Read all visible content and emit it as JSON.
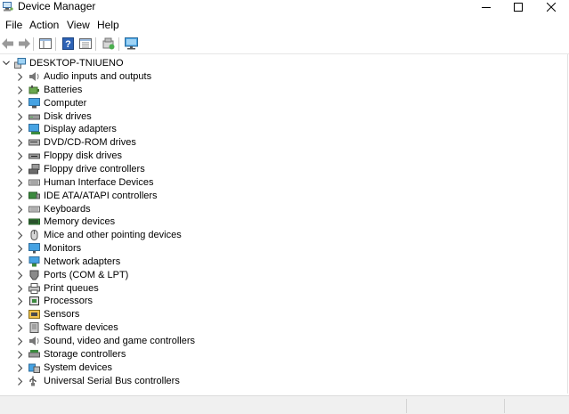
{
  "window": {
    "title": "Device Manager"
  },
  "menu": [
    "File",
    "Action",
    "View",
    "Help"
  ],
  "toolbar": {
    "buttons": [
      "back-arrow-icon",
      "forward-arrow-icon",
      "properties-panel-icon",
      "help-icon",
      "details-view-icon",
      "update-driver-icon",
      "monitor-scan-icon"
    ]
  },
  "tree": {
    "root": "DESKTOP-TNIUENO",
    "categories": [
      {
        "label": "Audio inputs and outputs",
        "icon": "speaker-icon"
      },
      {
        "label": "Batteries",
        "icon": "battery-icon"
      },
      {
        "label": "Computer",
        "icon": "computer-icon"
      },
      {
        "label": "Disk drives",
        "icon": "disk-drive-icon"
      },
      {
        "label": "Display adapters",
        "icon": "display-adapter-icon"
      },
      {
        "label": "DVD/CD-ROM drives",
        "icon": "dvd-drive-icon"
      },
      {
        "label": "Floppy disk drives",
        "icon": "floppy-drive-icon"
      },
      {
        "label": "Floppy drive controllers",
        "icon": "floppy-controller-icon"
      },
      {
        "label": "Human Interface Devices",
        "icon": "hid-icon"
      },
      {
        "label": "IDE ATA/ATAPI controllers",
        "icon": "ide-controller-icon"
      },
      {
        "label": "Keyboards",
        "icon": "keyboard-icon"
      },
      {
        "label": "Memory devices",
        "icon": "memory-icon"
      },
      {
        "label": "Mice and other pointing devices",
        "icon": "mouse-icon"
      },
      {
        "label": "Monitors",
        "icon": "monitor-icon"
      },
      {
        "label": "Network adapters",
        "icon": "network-adapter-icon"
      },
      {
        "label": "Ports (COM & LPT)",
        "icon": "port-icon"
      },
      {
        "label": "Print queues",
        "icon": "printer-icon"
      },
      {
        "label": "Processors",
        "icon": "processor-icon"
      },
      {
        "label": "Sensors",
        "icon": "sensor-icon"
      },
      {
        "label": "Software devices",
        "icon": "software-device-icon"
      },
      {
        "label": "Sound, video and game controllers",
        "icon": "sound-controller-icon"
      },
      {
        "label": "Storage controllers",
        "icon": "storage-controller-icon"
      },
      {
        "label": "System devices",
        "icon": "system-devices-icon"
      },
      {
        "label": "Universal Serial Bus controllers",
        "icon": "usb-icon"
      }
    ]
  },
  "colors": {
    "accent": "#1f6fc8",
    "toolbar_disabled": "#9a9a9a"
  }
}
